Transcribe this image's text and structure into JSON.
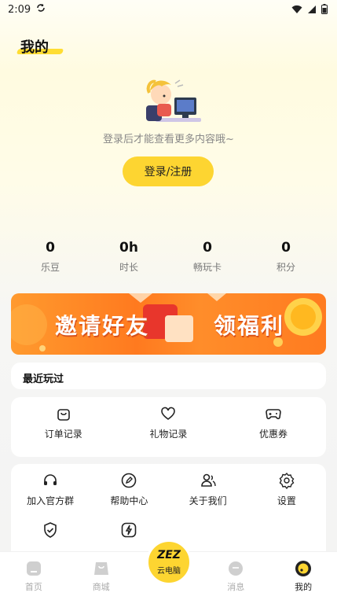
{
  "status_bar": {
    "time": "2:09"
  },
  "page": {
    "title": "我的"
  },
  "profile": {
    "login_hint": "登录后才能查看更多内容哦~",
    "login_button": "登录/注册"
  },
  "stats": [
    {
      "value": "0",
      "label": "乐豆"
    },
    {
      "value": "0h",
      "label": "时长"
    },
    {
      "value": "0",
      "label": "畅玩卡"
    },
    {
      "value": "0",
      "label": "积分"
    }
  ],
  "banner": {
    "text_left": "邀请好友",
    "text_right": "领福利"
  },
  "recent": {
    "title": "最近玩过"
  },
  "shortcuts": [
    {
      "label": "订单记录",
      "icon": "bag-icon"
    },
    {
      "label": "礼物记录",
      "icon": "heart-icon"
    },
    {
      "label": "优惠券",
      "icon": "gamepad-icon"
    }
  ],
  "services": [
    {
      "label": "加入官方群",
      "icon": "headset-icon"
    },
    {
      "label": "帮助中心",
      "icon": "edit-icon"
    },
    {
      "label": "关于我们",
      "icon": "users-icon"
    },
    {
      "label": "设置",
      "icon": "gear-icon"
    },
    {
      "label": "",
      "icon": "shield-icon"
    },
    {
      "label": "",
      "icon": "lightning-icon"
    }
  ],
  "bottom_nav": {
    "items": [
      {
        "label": "首页",
        "icon": "home-icon"
      },
      {
        "label": "商城",
        "icon": "shop-icon"
      },
      {
        "label": "消息",
        "icon": "message-icon"
      },
      {
        "label": "我的",
        "icon": "profile-icon",
        "active": true
      }
    ],
    "center": {
      "logo": "ZEZ",
      "label": "云电脑"
    }
  },
  "colors": {
    "accent": "#fdd531",
    "banner": "#ff8a25"
  }
}
